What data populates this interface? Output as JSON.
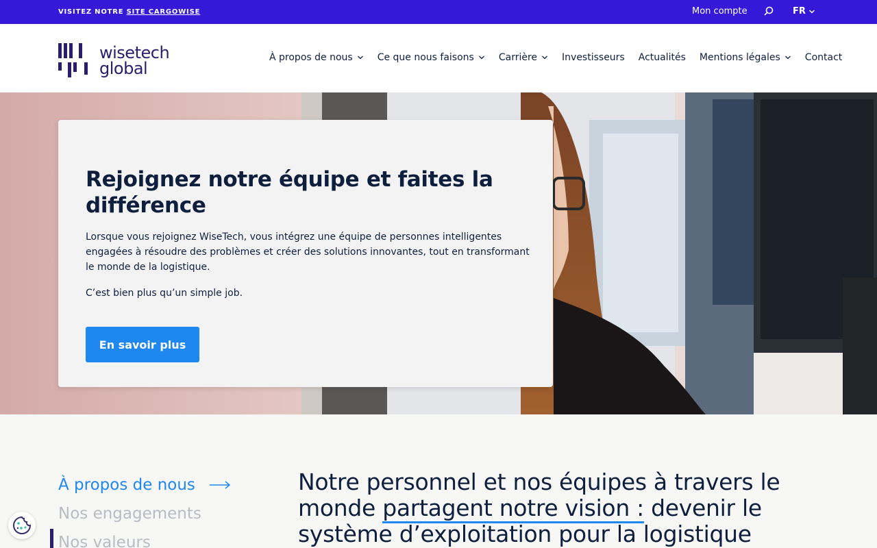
{
  "topbar": {
    "promo_prefix": "VISITEZ NOTRE ",
    "promo_link": "SITE CARGOWISE",
    "account": "Mon compte",
    "lang": "FR"
  },
  "logo": {
    "line1": "wisetech",
    "line2": "global"
  },
  "nav": {
    "items": [
      {
        "label": "À propos de nous",
        "dropdown": true
      },
      {
        "label": "Ce que nous faisons",
        "dropdown": true
      },
      {
        "label": "Carrière",
        "dropdown": true
      },
      {
        "label": "Investisseurs",
        "dropdown": false
      },
      {
        "label": "Actualités",
        "dropdown": false
      },
      {
        "label": "Mentions légales",
        "dropdown": true
      },
      {
        "label": "Contact",
        "dropdown": false
      }
    ]
  },
  "hero": {
    "title": "Rejoignez notre équipe et faites la différence",
    "paragraph1": "Lorsque vous rejoignez WiseTech, vous intégrez une équipe de personnes intelligentes engagées à résoudre des problèmes et créer des solutions innovantes, tout en transformant le monde de la logistique.",
    "paragraph2": "C’est bien plus qu’un simple job.",
    "button": "En savoir plus"
  },
  "side_nav": {
    "items": [
      {
        "label": "À propos de nous",
        "active": true
      },
      {
        "label": "Nos engagements",
        "active": false
      },
      {
        "label": "Nos valeurs",
        "active": false
      }
    ]
  },
  "intro": {
    "part1": "Notre personnel et nos équipes à travers le monde ",
    "highlight": "partagent notre vision :",
    "part2": " devenir le système d’exploitation pour la logistique"
  },
  "colors": {
    "topbar": "#3618d9",
    "accent": "#1e87f0",
    "navy": "#0e1f3e",
    "brand": "#2b1c6e"
  }
}
